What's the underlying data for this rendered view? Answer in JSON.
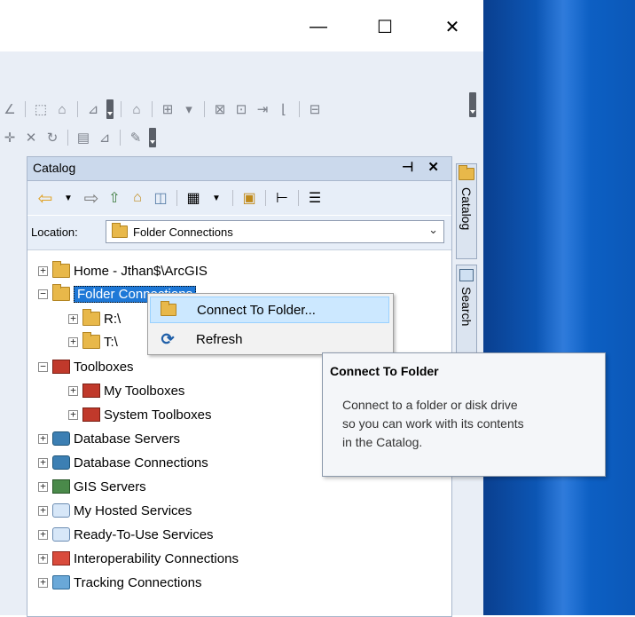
{
  "window": {
    "minimize_glyph": "—",
    "maximize_glyph": "☐",
    "close_glyph": "✕"
  },
  "catalog": {
    "title": "Catalog",
    "pin_glyph": "⊣",
    "close_glyph": "✕",
    "location_label": "Location:",
    "location_value": "Folder Connections"
  },
  "tree": {
    "items": [
      {
        "label": "Home - Jthan$\\ArcGIS",
        "icon": "home-folder-icon"
      },
      {
        "label": "Folder Connections",
        "icon": "folder-connections-icon"
      },
      {
        "label": "R:\\",
        "icon": "folder-icon"
      },
      {
        "label": "T:\\",
        "icon": "folder-icon"
      },
      {
        "label": "Toolboxes",
        "icon": "toolbox-icon"
      },
      {
        "label": "My Toolboxes",
        "icon": "toolbox-icon"
      },
      {
        "label": "System Toolboxes",
        "icon": "toolbox-icon"
      },
      {
        "label": "Database Servers",
        "icon": "database-server-icon"
      },
      {
        "label": "Database Connections",
        "icon": "database-connection-icon"
      },
      {
        "label": "GIS Servers",
        "icon": "gis-server-icon"
      },
      {
        "label": "My Hosted Services",
        "icon": "hosted-services-icon"
      },
      {
        "label": "Ready-To-Use Services",
        "icon": "ready-services-icon"
      },
      {
        "label": "Interoperability Connections",
        "icon": "interop-icon"
      },
      {
        "label": "Tracking Connections",
        "icon": "tracking-icon"
      }
    ],
    "expand_glyph": "+",
    "collapse_glyph": "−"
  },
  "side_tabs": {
    "catalog": "Catalog",
    "search": "Search"
  },
  "context_menu": {
    "items": [
      {
        "label": "Connect To Folder...",
        "icon": "connect-folder-icon"
      },
      {
        "label": "Refresh",
        "icon": "refresh-icon"
      }
    ]
  },
  "tooltip": {
    "title": "Connect To Folder",
    "body": "Connect to a folder or disk drive\nso you can work with its contents\nin the Catalog."
  },
  "colors": {
    "selection": "#1e78d7",
    "menu_hover": "#cce8ff",
    "desktop": "#0e63c9"
  }
}
